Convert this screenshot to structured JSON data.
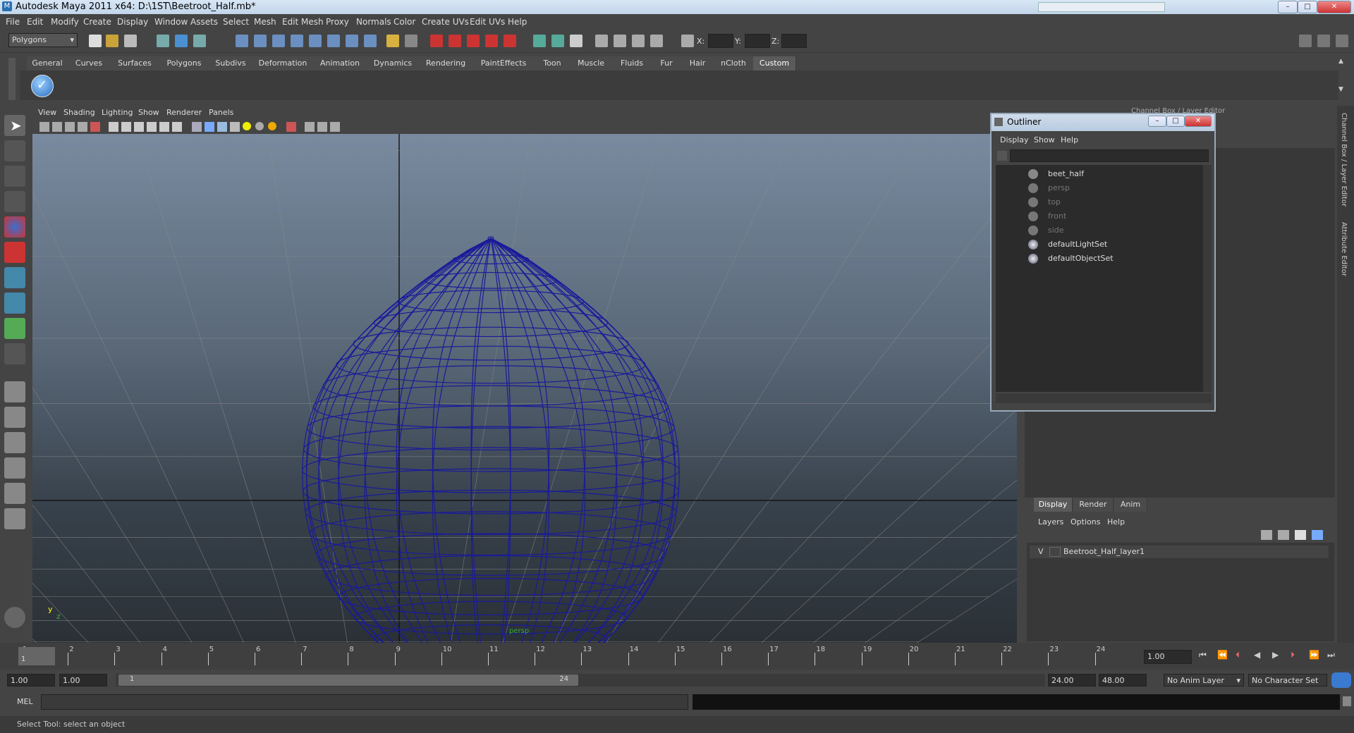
{
  "window": {
    "title": "Autodesk Maya 2011 x64: D:\\1ST\\Beetroot_Half.mb*"
  },
  "menubar": [
    "File",
    "Edit",
    "Modify",
    "Create",
    "Display",
    "Window",
    "Assets",
    "Select",
    "Mesh",
    "Edit Mesh",
    "Proxy",
    "Normals",
    "Color",
    "Create UVs",
    "Edit UVs",
    "Help"
  ],
  "mode_selector": "Polygons",
  "coords": {
    "x_label": "X:",
    "y_label": "Y:",
    "z_label": "Z:"
  },
  "shelf_tabs": [
    "General",
    "Curves",
    "Surfaces",
    "Polygons",
    "Subdivs",
    "Deformation",
    "Animation",
    "Dynamics",
    "Rendering",
    "PaintEffects",
    "Toon",
    "Muscle",
    "Fluids",
    "Fur",
    "Hair",
    "nCloth",
    "Custom"
  ],
  "active_shelf_tab": "Custom",
  "viewport": {
    "menu": [
      "View",
      "Shading",
      "Lighting",
      "Show",
      "Renderer",
      "Panels"
    ],
    "axis_y": "y",
    "axis_z": "z",
    "camera_label": "persp"
  },
  "outliner": {
    "title": "Outliner",
    "menu": [
      "Display",
      "Show",
      "Help"
    ],
    "items": [
      {
        "label": "beet_half",
        "dim": false,
        "icon": "transform-icon"
      },
      {
        "label": "persp",
        "dim": true,
        "icon": "camera-icon"
      },
      {
        "label": "top",
        "dim": true,
        "icon": "camera-icon"
      },
      {
        "label": "front",
        "dim": true,
        "icon": "camera-icon"
      },
      {
        "label": "side",
        "dim": true,
        "icon": "camera-icon"
      },
      {
        "label": "defaultLightSet",
        "dim": false,
        "icon": "set-icon"
      },
      {
        "label": "defaultObjectSet",
        "dim": false,
        "icon": "set-icon"
      }
    ]
  },
  "channel_box": {
    "header": "Channel Box / Layer Editor",
    "side_tabs": [
      "Channel Box / Layer Editor",
      "Attribute Editor"
    ],
    "layer_tabs": [
      "Display",
      "Render",
      "Anim"
    ],
    "active_layer_tab": "Display",
    "layer_menu": [
      "Layers",
      "Options",
      "Help"
    ],
    "layer": {
      "visibility": "V",
      "name": "Beetroot_Half_layer1"
    }
  },
  "timeline": {
    "ticks": [
      "1",
      "2",
      "3",
      "4",
      "5",
      "6",
      "7",
      "8",
      "9",
      "10",
      "11",
      "12",
      "13",
      "14",
      "15",
      "16",
      "17",
      "18",
      "19",
      "20",
      "21",
      "22",
      "23",
      "24"
    ],
    "current_frame": "1.00",
    "current_marker": "1"
  },
  "range": {
    "start": "1.00",
    "inner_start": "1.00",
    "slider_start": "1",
    "slider_end": "24",
    "inner_end": "24.00",
    "end": "48.00",
    "anim_layer": "No Anim Layer",
    "character_set": "No Character Set"
  },
  "cmdline": {
    "label": "MEL"
  },
  "helpline": {
    "text": "Select Tool: select an object"
  },
  "colors": {
    "wire": "#1a1a9a",
    "grid": "#8a8a8a",
    "viewport_top": "#7d8fa5",
    "viewport_bottom": "#2a3036"
  }
}
